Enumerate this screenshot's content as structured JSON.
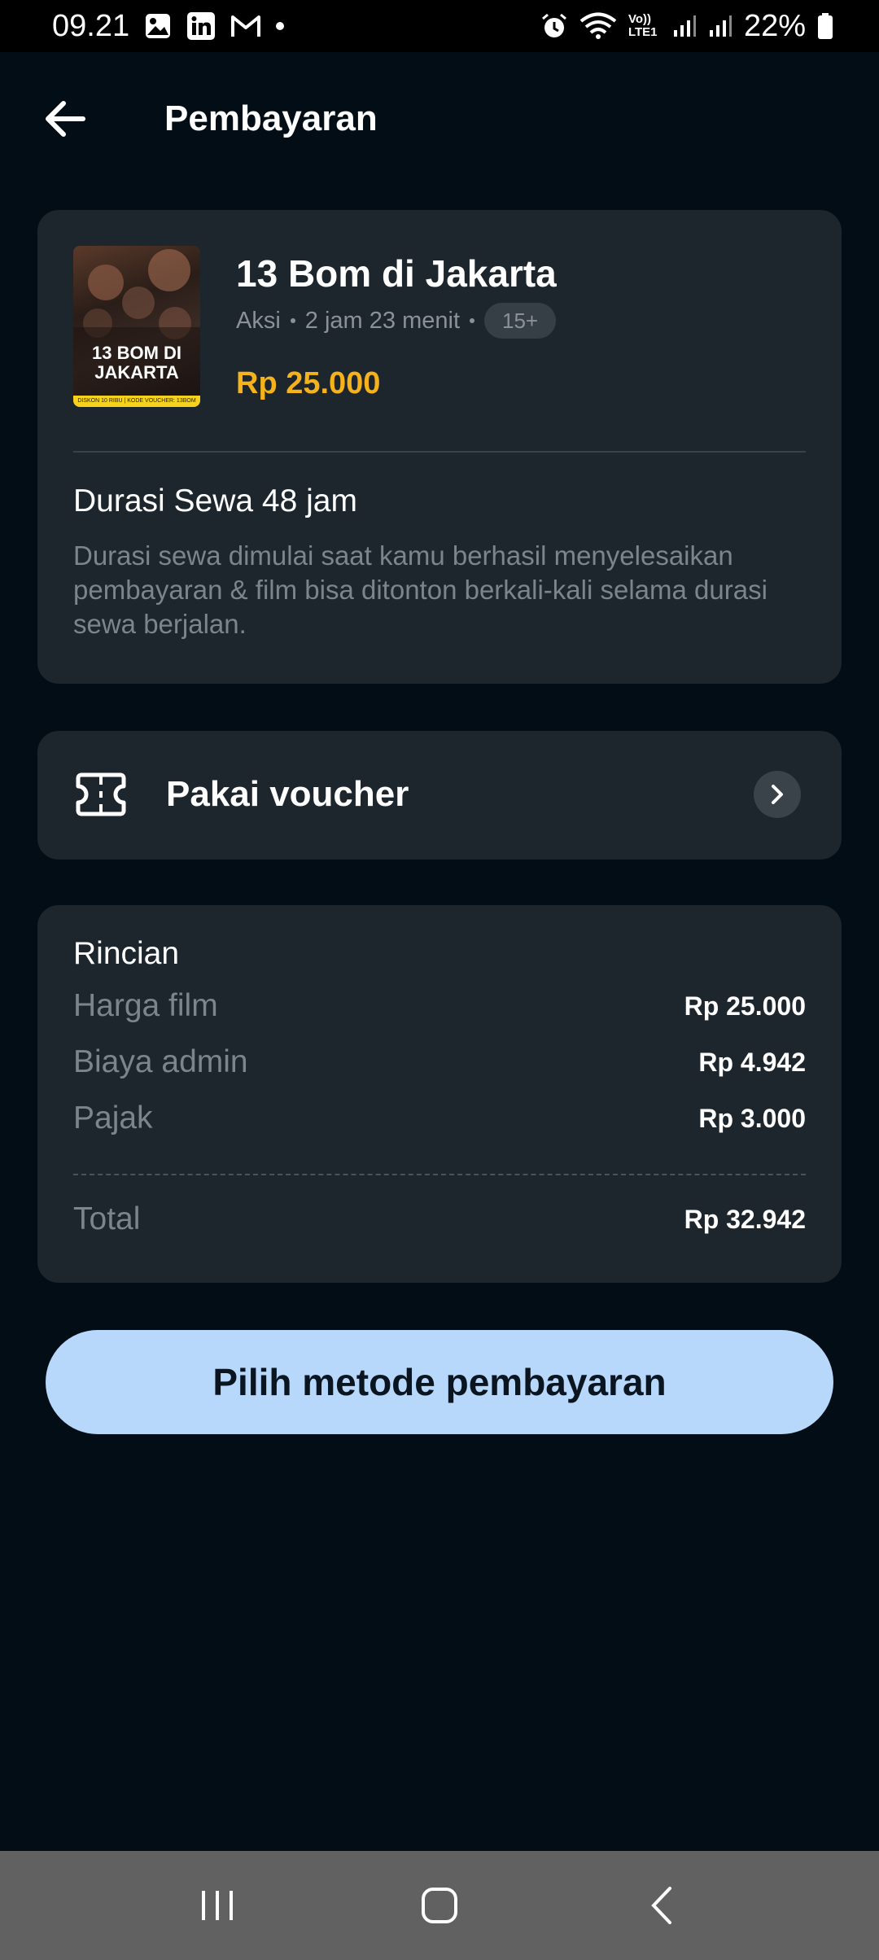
{
  "status_bar": {
    "time": "09.21",
    "battery": "22%",
    "network_label": "Vo)) LTE1",
    "icons": [
      "gallery-icon",
      "linkedin-icon",
      "gmail-icon",
      "dot-icon",
      "alarm-icon",
      "wifi-icon",
      "signal-icon",
      "signal-icon",
      "battery-icon"
    ]
  },
  "header": {
    "title": "Pembayaran",
    "back_icon": "arrow-left-icon"
  },
  "movie": {
    "title": "13 Bom di Jakarta",
    "genre": "Aksi",
    "duration": "2 jam 23 menit",
    "rating": "15+",
    "price": "Rp 25.000",
    "poster_title": "13 BOM DI JAKARTA",
    "poster_strip": "DISKON 10 RIBU | KODE VOUCHER: 13BOM"
  },
  "rental": {
    "title": "Durasi Sewa 48 jam",
    "description": "Durasi sewa dimulai saat kamu berhasil menyelesaikan pembayaran & film bisa ditonton berkali-kali selama durasi sewa berjalan."
  },
  "voucher": {
    "label": "Pakai voucher",
    "icon": "ticket-icon"
  },
  "details": {
    "title": "Rincian",
    "items": [
      {
        "label": "Harga film",
        "value": "Rp 25.000"
      },
      {
        "label": "Biaya admin",
        "value": "Rp 4.942"
      },
      {
        "label": "Pajak",
        "value": "Rp 3.000"
      }
    ],
    "total_label": "Total",
    "total_value": "Rp 32.942"
  },
  "cta": {
    "label": "Pilih metode pembayaran"
  },
  "colors": {
    "background": "#030d15",
    "card": "#1d252d",
    "accent_price": "#f5b21b",
    "cta_bg": "#b7d8fb",
    "nav_bar": "#616161"
  }
}
